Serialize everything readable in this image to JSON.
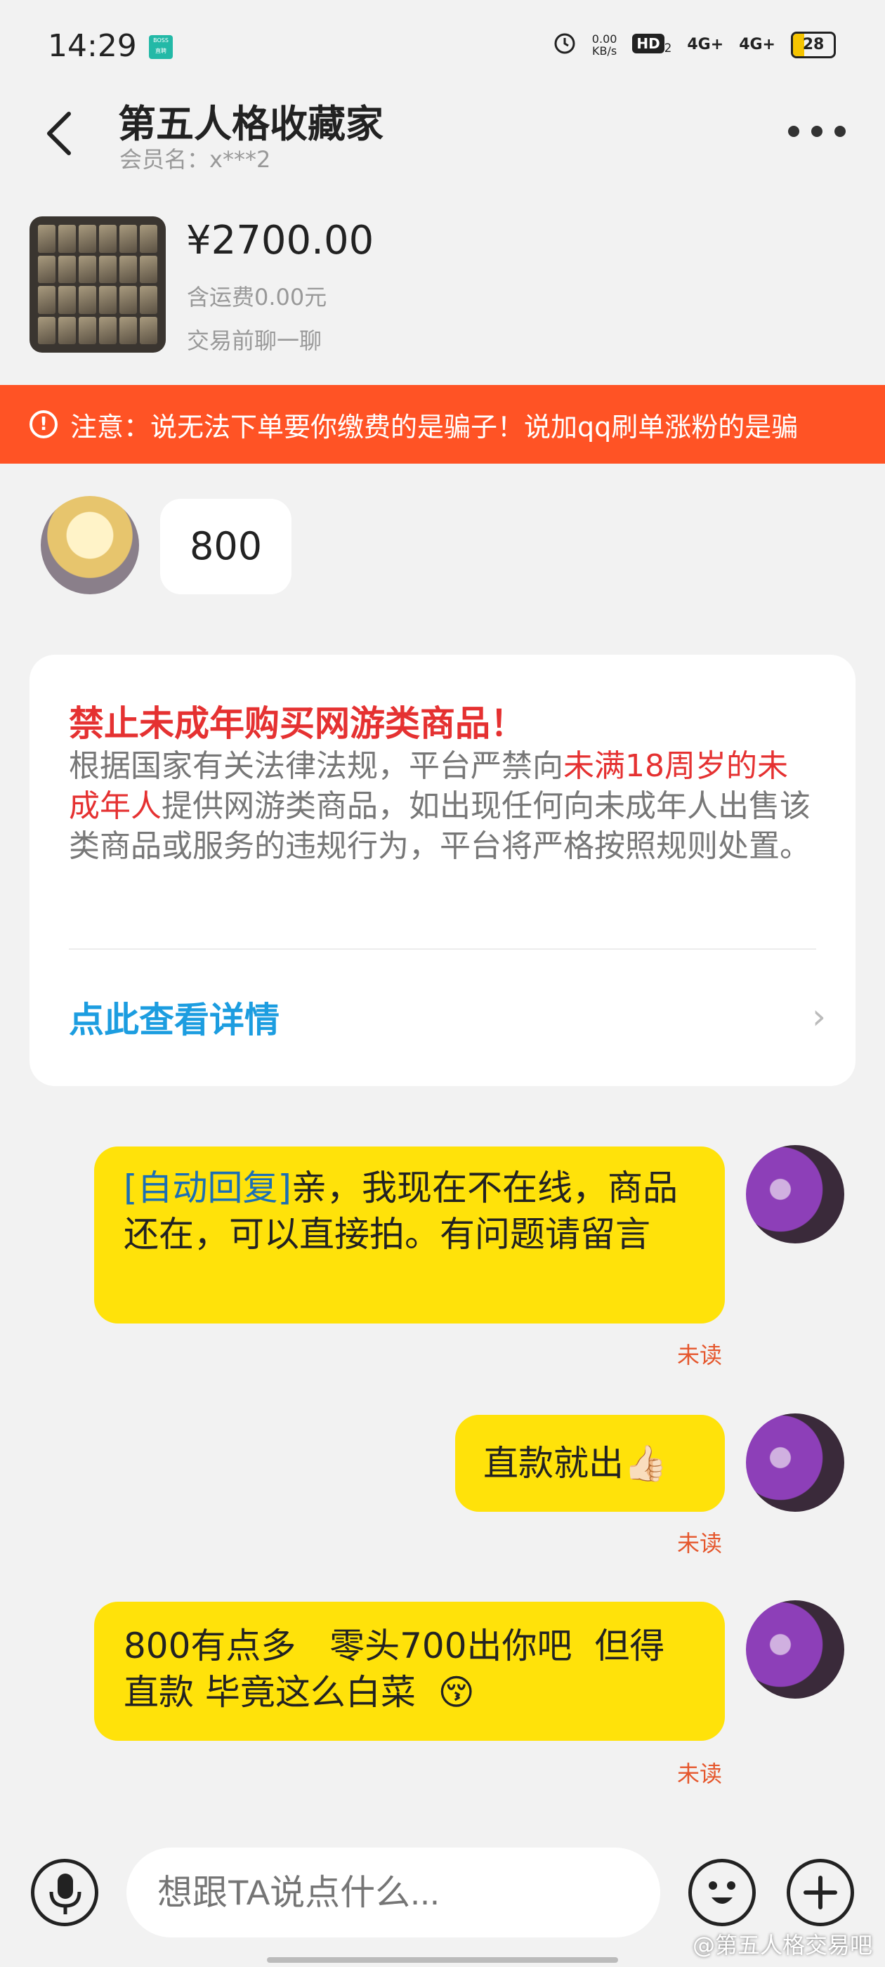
{
  "status_bar": {
    "time": "14:29",
    "boss_badge": "BOSS\n直聘",
    "net_speed_value": "0.00",
    "net_speed_unit": "KB/s",
    "hd_label": "HD",
    "hd_sub": "2",
    "signal_1": "4G+",
    "signal_2": "4G+",
    "battery": "28"
  },
  "header": {
    "title": "第五人格收藏家",
    "member_label": "会员名：",
    "member_name": "x***2"
  },
  "product": {
    "price": "¥2700.00",
    "shipping": "含运费0.00元",
    "chat_hint": "交易前聊一聊"
  },
  "banner": {
    "text": "注意：说无法下单要你缴费的是骗子！说加qq刷单涨粉的是骗"
  },
  "incoming": {
    "text": "800"
  },
  "notice": {
    "title": "禁止未成年购买网游类商品！",
    "body_1": "根据国家有关法律法规，平台严禁向",
    "body_red": "未满18周岁的未成年人",
    "body_2": "提供网游类商品，如出现任何向未成年人出售该类商品或服务的违规行为，平台将严格按照规则处置。",
    "link": "点此查看详情"
  },
  "messages": [
    {
      "tag": "[自动回复]",
      "text": "亲，我现在不在线，商品还在，可以直接拍。有问题请留言",
      "status": "未读"
    },
    {
      "tag": "",
      "text": "直款就出👍🏻",
      "status": "未读"
    },
    {
      "tag": "",
      "text": "800有点多   零头700出你吧  但得直款 毕竟这么白菜  😚",
      "status": "未读"
    }
  ],
  "input": {
    "placeholder": "想跟TA说点什么..."
  },
  "watermark": "@第五人格交易吧",
  "colors": {
    "banner": "#ff5325",
    "bubble_out": "#ffe20a",
    "warning_red": "#e53131",
    "link_blue": "#1c9de0",
    "unread": "#e5572d"
  }
}
